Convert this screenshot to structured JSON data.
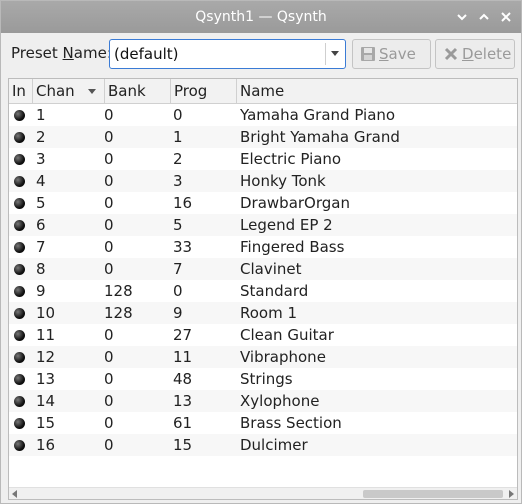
{
  "window": {
    "title": "Qsynth1 — Qsynth"
  },
  "preset": {
    "label_pre": "Preset ",
    "label_underlined": "N",
    "label_post": "ame:",
    "value": "(default)",
    "save_label": "Save",
    "save_underlined": "S",
    "save_rest": "ave",
    "delete_label": "Delete",
    "delete_underlined": "D",
    "delete_rest": "elete"
  },
  "table": {
    "columns": [
      "In",
      "Chan",
      "Bank",
      "Prog",
      "Name"
    ],
    "sort_column": "Chan",
    "rows": [
      {
        "chan": "1",
        "bank": "0",
        "prog": "0",
        "name": "Yamaha Grand Piano"
      },
      {
        "chan": "2",
        "bank": "0",
        "prog": "1",
        "name": "Bright Yamaha Grand"
      },
      {
        "chan": "3",
        "bank": "0",
        "prog": "2",
        "name": "Electric Piano"
      },
      {
        "chan": "4",
        "bank": "0",
        "prog": "3",
        "name": "Honky Tonk"
      },
      {
        "chan": "5",
        "bank": "0",
        "prog": "16",
        "name": "DrawbarOrgan"
      },
      {
        "chan": "6",
        "bank": "0",
        "prog": "5",
        "name": "Legend EP 2"
      },
      {
        "chan": "7",
        "bank": "0",
        "prog": "33",
        "name": "Fingered Bass"
      },
      {
        "chan": "8",
        "bank": "0",
        "prog": "7",
        "name": "Clavinet"
      },
      {
        "chan": "9",
        "bank": "128",
        "prog": "0",
        "name": "Standard"
      },
      {
        "chan": "10",
        "bank": "128",
        "prog": "9",
        "name": "Room 1"
      },
      {
        "chan": "11",
        "bank": "0",
        "prog": "27",
        "name": "Clean Guitar"
      },
      {
        "chan": "12",
        "bank": "0",
        "prog": "11",
        "name": "Vibraphone"
      },
      {
        "chan": "13",
        "bank": "0",
        "prog": "48",
        "name": "Strings"
      },
      {
        "chan": "14",
        "bank": "0",
        "prog": "13",
        "name": "Xylophone"
      },
      {
        "chan": "15",
        "bank": "0",
        "prog": "61",
        "name": "Brass Section"
      },
      {
        "chan": "16",
        "bank": "0",
        "prog": "15",
        "name": "Dulcimer"
      }
    ]
  }
}
